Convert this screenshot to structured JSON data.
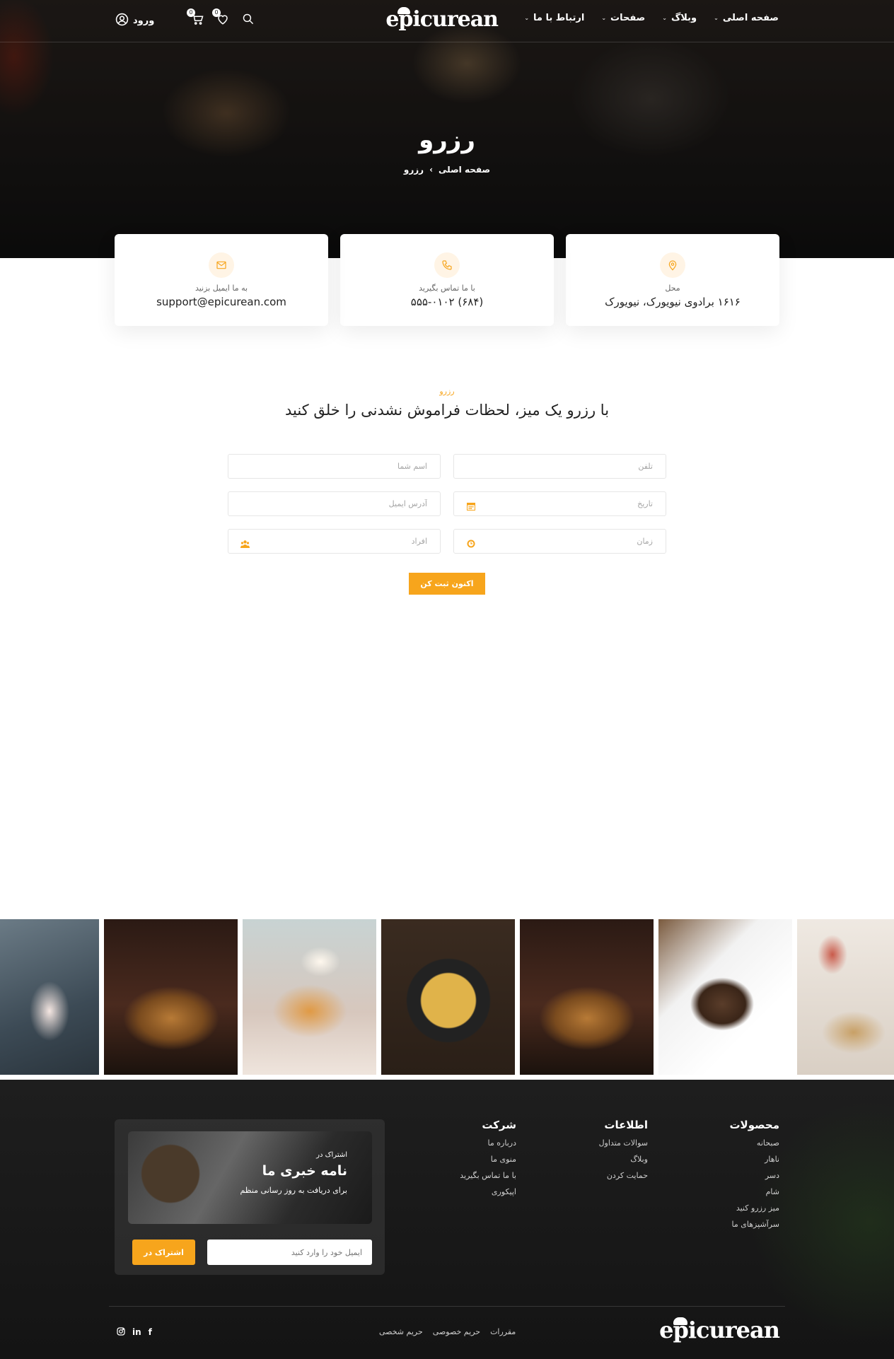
{
  "nav": {
    "items": [
      "صفحه اصلی",
      "وبلاگ",
      "صفحات",
      "ارتباط با ما"
    ],
    "logo": "epicurean",
    "wishlist_count": "0",
    "cart_count": "0",
    "login_label": "ورود"
  },
  "hero": {
    "title": "رزرو",
    "breadcrumb_home": "صفحه اصلی",
    "breadcrumb_separator": "›",
    "breadcrumb_current": "رزرو"
  },
  "contact_cards": [
    {
      "label": "به ما ایمیل بزنید",
      "value": "support@epicurean.com",
      "icon": "mail-icon"
    },
    {
      "label": "با ما تماس بگیرید",
      "value": "(۶۸۴) ۵۵۵-۰۱۰۲",
      "icon": "phone-icon"
    },
    {
      "label": "محل",
      "value": "۱۶۱۶ برادوی نیویورک، نیویورک",
      "icon": "location-pin-icon"
    }
  ],
  "reservation": {
    "tag": "رزرو",
    "title": "با رزرو یک میز، لحظات فراموش نشدنی را خلق کنید",
    "name_placeholder": "اسم شما",
    "phone_placeholder": "تلفن",
    "email_placeholder": "آدرس ایمیل",
    "date_placeholder": "تاریخ",
    "people_placeholder": "افراد",
    "time_placeholder": "زمان",
    "submit_label": "اکنون ثبت کن"
  },
  "footer": {
    "columns": [
      {
        "title": "محصولات",
        "links": [
          "صبحانه",
          "ناهار",
          "دسر",
          "شام",
          "میز رزرو کنید",
          "سرآشپزهای ما"
        ]
      },
      {
        "title": "اطلاعات",
        "links": [
          "سوالات متداول",
          "وبلاگ",
          "حمایت کردن"
        ]
      },
      {
        "title": "شرکت",
        "links": [
          "درباره ما",
          "منوی ما",
          "با ما تماس بگیرید",
          "اپیکوری"
        ]
      }
    ],
    "newsletter": {
      "small": "اشتراک در",
      "title": "نامه خبری ما",
      "subtitle": "برای دریافت به روز رسانی منظم",
      "placeholder": "ایمیل خود را وارد کنید",
      "button": "اشتراک در"
    },
    "logo": "epicurean",
    "legal": [
      "مقررات",
      "حریم خصوصی",
      "حریم شخصی"
    ],
    "social": [
      "instagram-icon",
      "linkedin-icon",
      "facebook-icon"
    ]
  },
  "colors": {
    "accent": "#f7a51c",
    "footer_bg": "#1a1a1a"
  }
}
